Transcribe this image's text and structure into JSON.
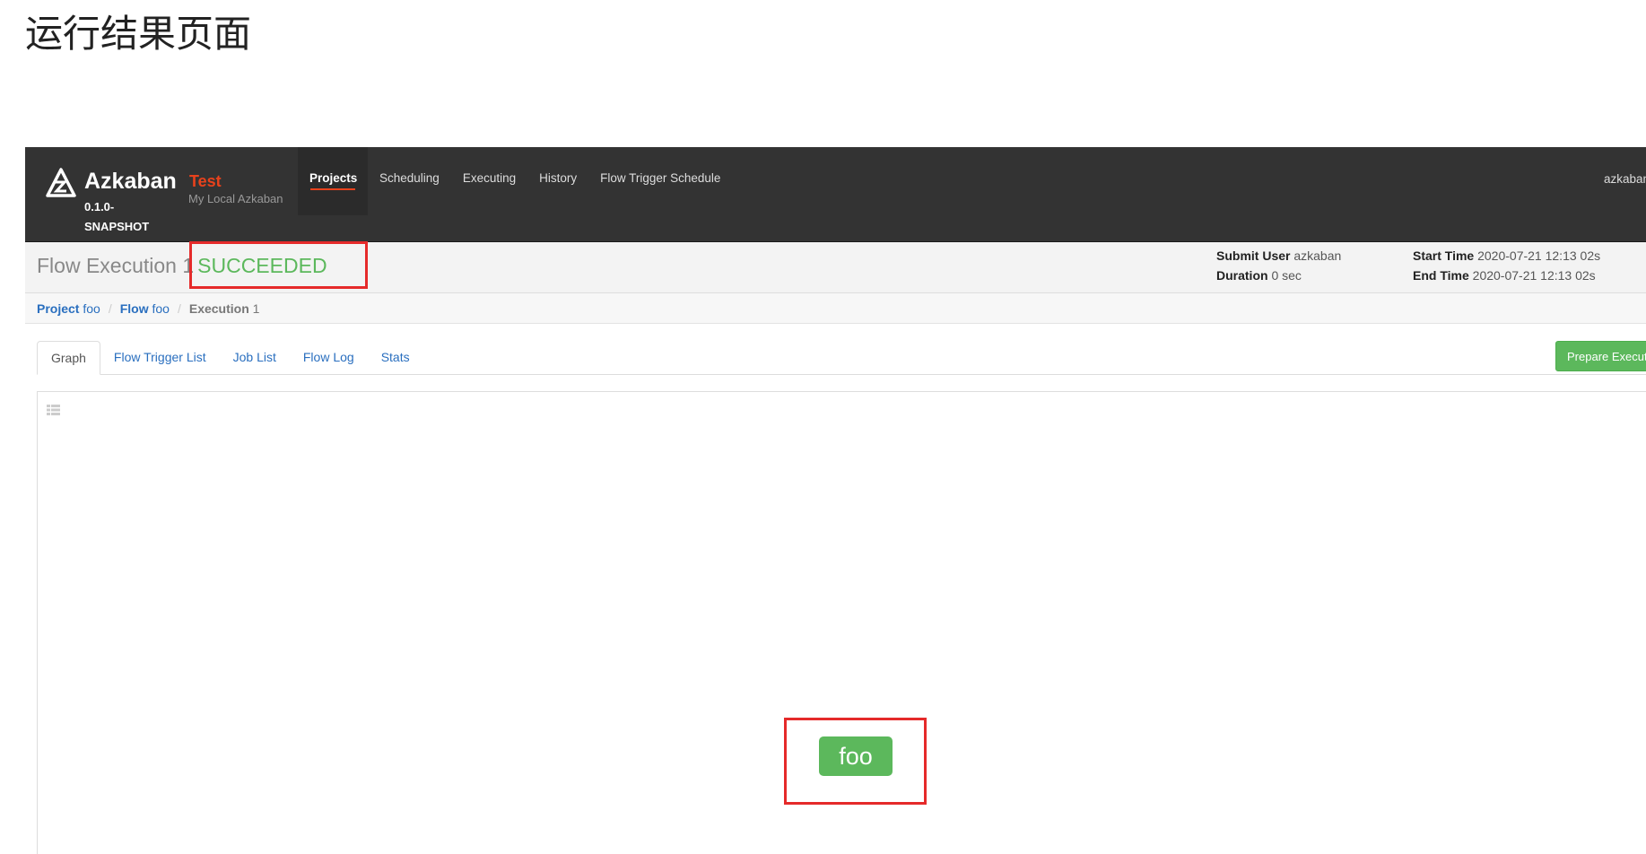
{
  "doc": {
    "heading": "运行结果页面"
  },
  "navbar": {
    "brand": "Azkaban",
    "version": "0.1.0-SNAPSHOT",
    "env_name": "Test",
    "env_desc": "My Local Azkaban",
    "items": [
      {
        "label": "Projects",
        "active": true
      },
      {
        "label": "Scheduling"
      },
      {
        "label": "Executing"
      },
      {
        "label": "History"
      },
      {
        "label": "Flow Trigger Schedule"
      }
    ],
    "user": "azkaban"
  },
  "execution": {
    "title": "Flow Execution 1",
    "status": "SUCCEEDED",
    "status_color": "#5cb85c",
    "submit_user_label": "Submit User",
    "submit_user": "azkaban",
    "duration_label": "Duration",
    "duration": "0 sec",
    "start_time_label": "Start Time",
    "start_time": "2020-07-21 12:13 02s",
    "end_time_label": "End Time",
    "end_time": "2020-07-21 12:13 02s"
  },
  "breadcrumb": {
    "project_label": "Project",
    "project": "foo",
    "flow_label": "Flow",
    "flow": "foo",
    "execution_label": "Execution",
    "execution": "1"
  },
  "tabs": [
    "Graph",
    "Flow Trigger List",
    "Job List",
    "Flow Log",
    "Stats"
  ],
  "actions": {
    "prepare_label": "Prepare Execution"
  },
  "graph": {
    "node_label": "foo",
    "node_color": "#5cb85c"
  },
  "annotation_color": "#e52a2a"
}
